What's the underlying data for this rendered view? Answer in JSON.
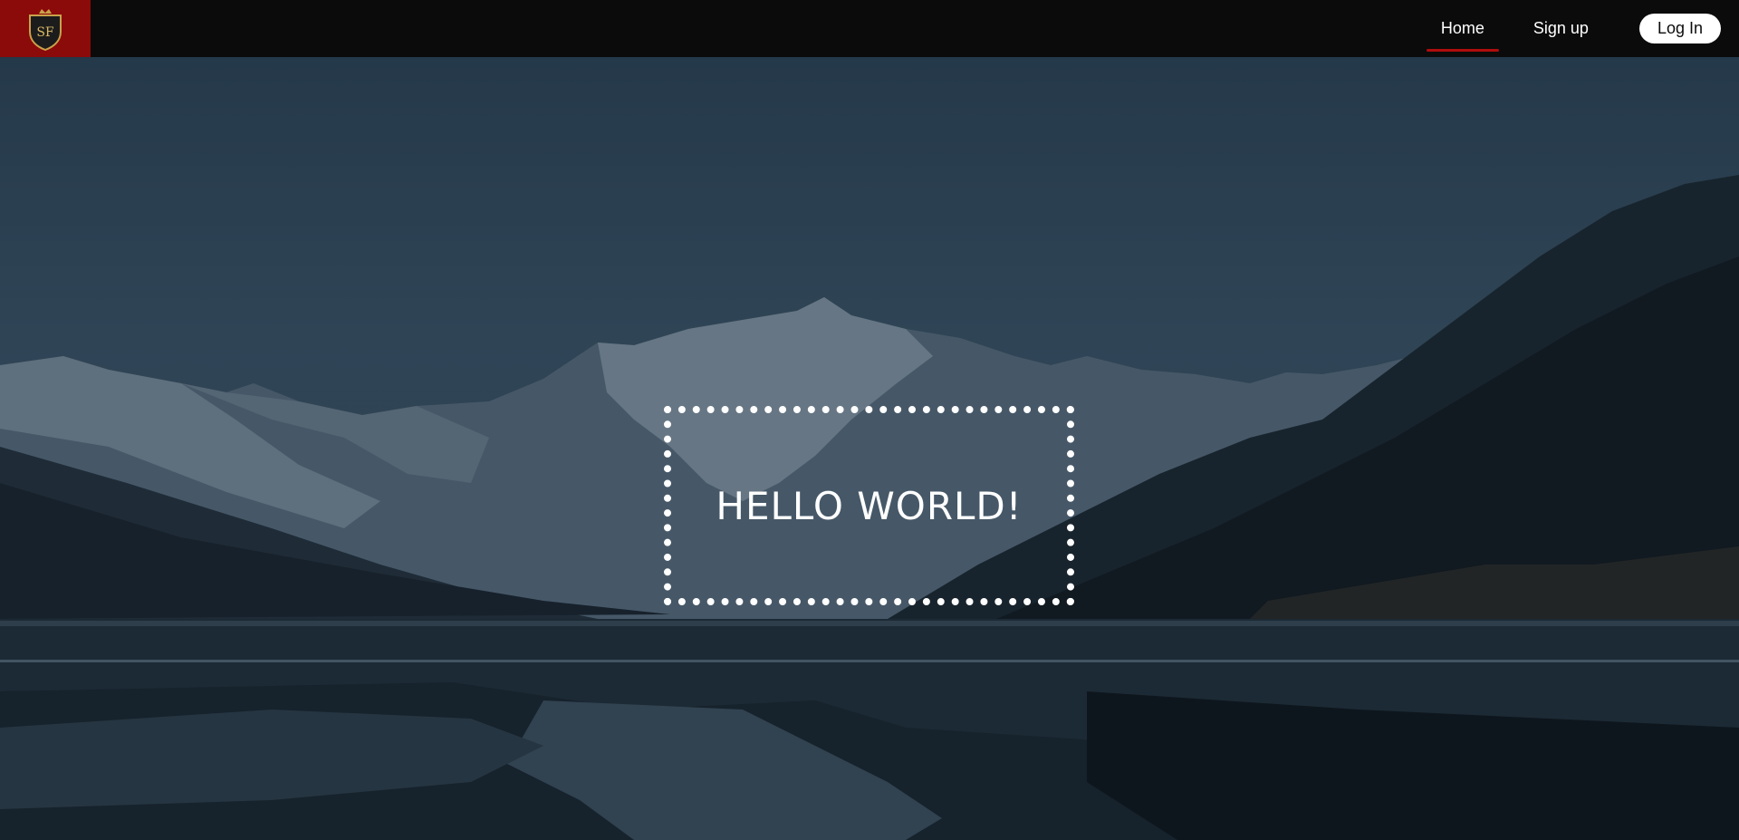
{
  "brand": {
    "logo_text": "SF",
    "logo_icon": "crest-shield-icon",
    "accent": "#8b0a0a"
  },
  "nav": {
    "items": [
      {
        "label": "Home",
        "active": true
      },
      {
        "label": "Sign up",
        "active": false
      }
    ],
    "login_label": "Log In",
    "active_indicator_color": "#b00d0d"
  },
  "hero": {
    "headline": "HELLO WORLD!",
    "background": "mountain-lake-image"
  }
}
